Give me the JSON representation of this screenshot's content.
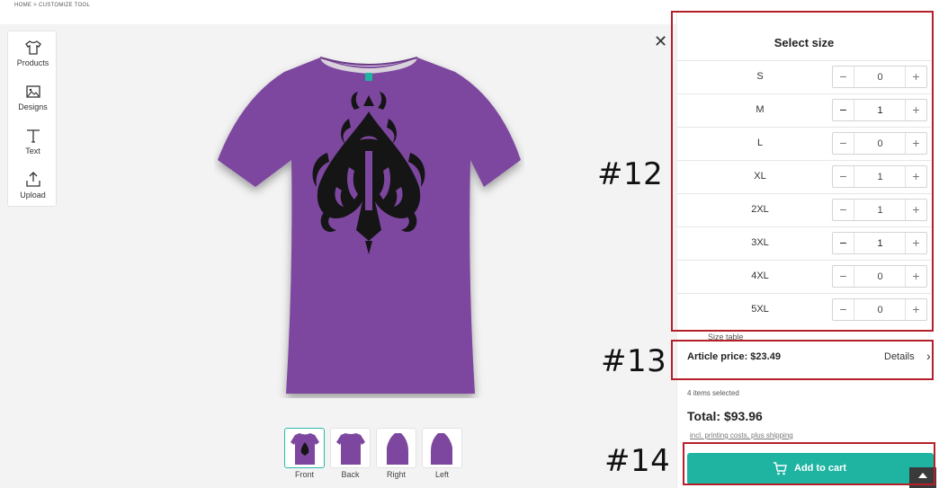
{
  "breadcrumb": "HOME > CUSTOMIZE TOOL",
  "toolbar": {
    "items": [
      {
        "label": "Products",
        "icon": "tshirt-icon"
      },
      {
        "label": "Designs",
        "icon": "image-icon"
      },
      {
        "label": "Text",
        "icon": "text-icon"
      },
      {
        "label": "Upload",
        "icon": "upload-icon"
      }
    ]
  },
  "product": {
    "color": "#7d479f",
    "design_color": "#151515",
    "collar_tag_color": "#1fb4a2"
  },
  "close_icon": "close-icon",
  "views": [
    {
      "label": "Front",
      "active": true
    },
    {
      "label": "Back",
      "active": false
    },
    {
      "label": "Right",
      "active": false
    },
    {
      "label": "Left",
      "active": false
    }
  ],
  "panel": {
    "title": "Select size",
    "sizes": [
      {
        "name": "S",
        "qty": "0"
      },
      {
        "name": "M",
        "qty": "1"
      },
      {
        "name": "L",
        "qty": "0"
      },
      {
        "name": "XL",
        "qty": "1"
      },
      {
        "name": "2XL",
        "qty": "1"
      },
      {
        "name": "3XL",
        "qty": "1"
      },
      {
        "name": "4XL",
        "qty": "0"
      },
      {
        "name": "5XL",
        "qty": "0"
      }
    ],
    "minus": "−",
    "plus": "+",
    "cut_off_text": "Size table",
    "article_price": "Article price: $23.49",
    "details": "Details",
    "items_selected": "4 items selected",
    "total": "Total: $93.96",
    "fine_print": "incl. printing costs, plus shipping",
    "add_to_cart": "Add to cart"
  },
  "annotations": [
    {
      "label": "#12"
    },
    {
      "label": "#13"
    },
    {
      "label": "#14"
    }
  ],
  "colors": {
    "accent": "#1fb4a2",
    "annotation": "#b4202a"
  }
}
